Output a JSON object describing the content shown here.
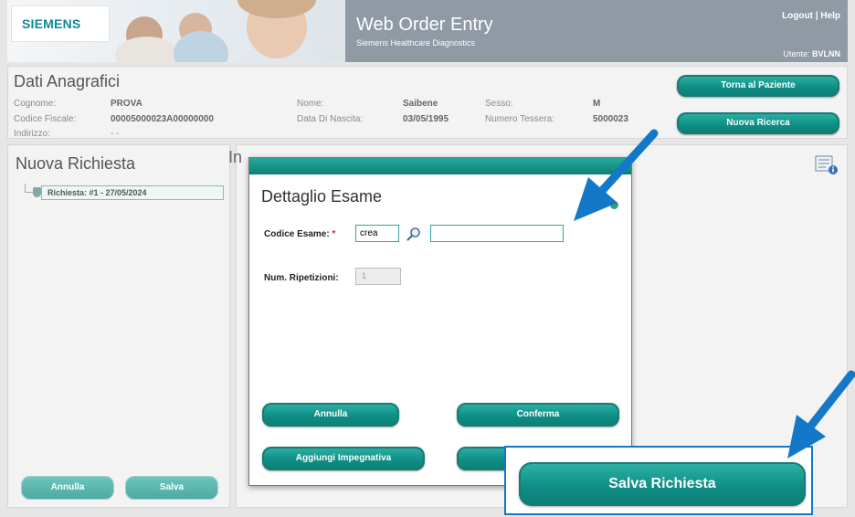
{
  "header": {
    "logo": "SIEMENS",
    "title": "Web Order Entry",
    "subtitle": "Siemens Healthcare Diagnostics",
    "logout": "Logout",
    "sep": "|",
    "help": "Help",
    "user_label": "Utente:",
    "user_value": "BVLNN"
  },
  "anagrafica": {
    "title": "Dati Anagrafici",
    "cognome_label": "Cognome:",
    "cognome": "PROVA",
    "nome_label": "Nome:",
    "nome": "Saibene",
    "sesso_label": "Sesso:",
    "sesso": "M",
    "cf_label": "Codice Fiscale:",
    "cf": "00005000023A00000000",
    "nascita_label": "Data Di Nascita:",
    "nascita": "03/05/1995",
    "tessera_label": "Numero Tessera:",
    "tessera": "5000023",
    "indirizzo_label": "Indirizzo:",
    "indirizzo": "- -",
    "btn_torna": "Torna al Paziente",
    "btn_nuova": "Nuova Ricerca"
  },
  "left": {
    "title": "Nuova Richiesta",
    "item": "Richiesta: #1 - 27/05/2024",
    "annulla": "Annulla",
    "salva": "Salva"
  },
  "main": {
    "title_fragment": "In"
  },
  "modal": {
    "title": "Dettaglio Esame",
    "codice_label": "Codice Esame:",
    "required_mark": "*",
    "codice_value": "crea",
    "ripetizioni_label": "Num. Ripetizioni:",
    "ripetizioni_value": "1",
    "annulla": "Annulla",
    "conferma": "Conferma",
    "aggiungi": "Aggiungi Impegnativa"
  },
  "callout": {
    "button": "Salva Richiesta"
  },
  "colors": {
    "teal": "#0f8f86",
    "arrow_blue": "#1478c8",
    "header_gray": "#8f9aa4"
  }
}
